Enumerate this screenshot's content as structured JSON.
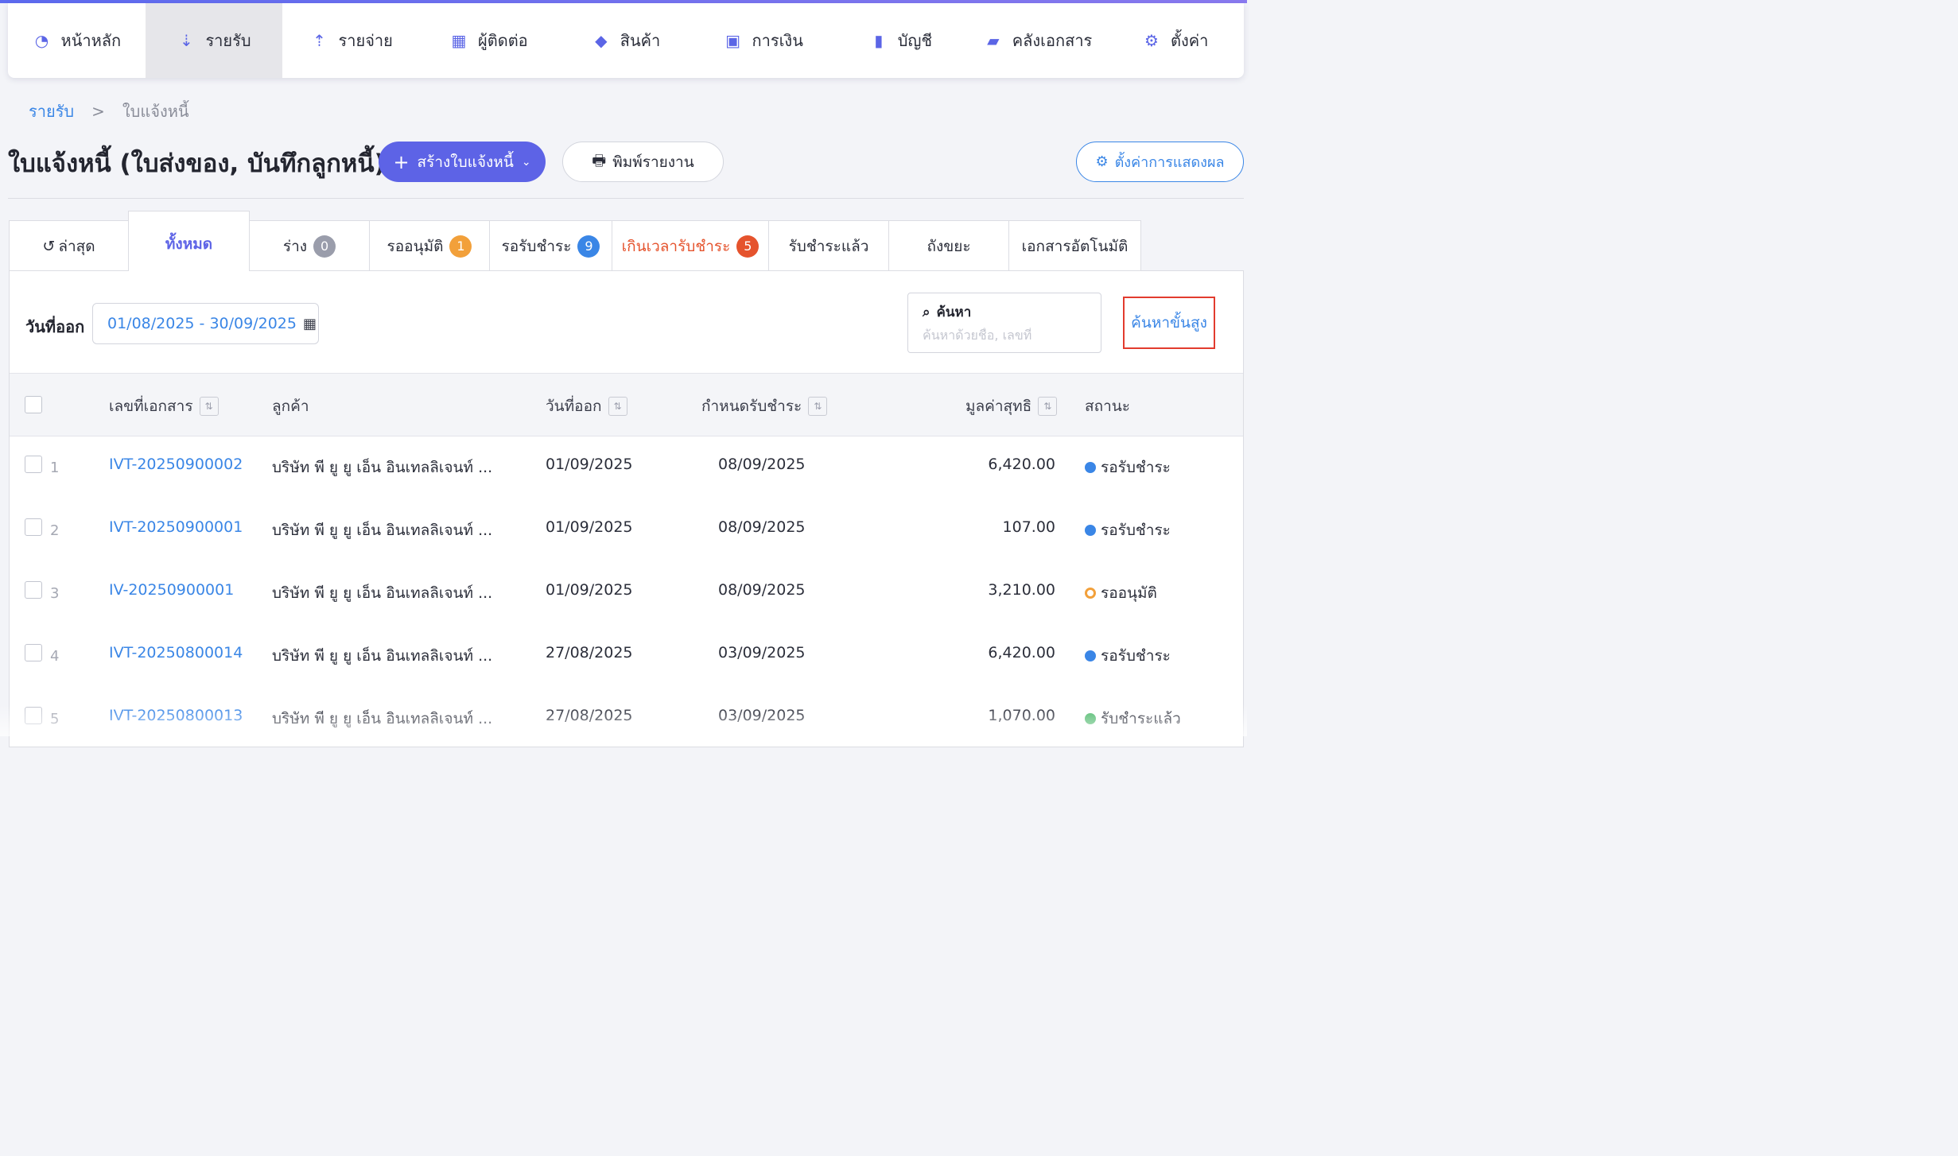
{
  "nav": {
    "items": [
      {
        "label": "หน้าหลัก",
        "icon": "gauge-icon",
        "glyph": "◔",
        "active": false
      },
      {
        "label": "รายรับ",
        "icon": "income-list-icon",
        "glyph": "⇣",
        "active": true
      },
      {
        "label": "รายจ่าย",
        "icon": "expense-list-icon",
        "glyph": "⇡",
        "active": false
      },
      {
        "label": "ผู้ติดต่อ",
        "icon": "building-icon",
        "glyph": "▦",
        "active": false
      },
      {
        "label": "สินค้า",
        "icon": "box-icon",
        "glyph": "◆",
        "active": false
      },
      {
        "label": "การเงิน",
        "icon": "money-icon",
        "glyph": "▣",
        "active": false
      },
      {
        "label": "บัญชี",
        "icon": "ledger-icon",
        "glyph": "▮",
        "active": false
      },
      {
        "label": "คลังเอกสาร",
        "icon": "folder-icon",
        "glyph": "▰",
        "active": false
      },
      {
        "label": "ตั้งค่า",
        "icon": "gear-icon",
        "glyph": "⚙",
        "active": false
      }
    ]
  },
  "breadcrumb": {
    "parent": "รายรับ",
    "separator": ">",
    "current": "ใบแจ้งหนี้"
  },
  "header": {
    "title": "ใบแจ้งหนี้ (ใบส่งของ, บันทึกลูกหนี้)",
    "create_label": "สร้างใบแจ้งหนี้",
    "print_label": "พิมพ์รายงาน",
    "display_settings_label": "ตั้งค่าการแสดงผล"
  },
  "tabs": [
    {
      "label": "ล่าสุด",
      "width": 151
    },
    {
      "label": "ทั้งหมด",
      "width": 153
    },
    {
      "label": "ร่าง",
      "badge": "0",
      "badge_color": "#9a9dab",
      "width": 152
    },
    {
      "label": "รออนุมัติ",
      "badge": "1",
      "badge_color": "#f2a03a",
      "width": 152
    },
    {
      "label": "รอรับชำระ",
      "badge": "9",
      "badge_color": "#3a86e6",
      "width": 155
    },
    {
      "label": "เกินเวลารับชำระ",
      "badge": "5",
      "badge_color": "#e5532d",
      "width": 198
    },
    {
      "label": "รับชำระแล้ว",
      "width": 152
    },
    {
      "label": "ถังขยะ",
      "width": 152
    },
    {
      "label": "เอกสารอัตโนมัติ",
      "width": 167
    }
  ],
  "filters": {
    "date_label": "วันที่ออก",
    "date_range": "01/08/2025 - 30/09/2025",
    "search_title": "ค้นหา",
    "search_placeholder": "ค้นหาด้วยชื่อ, เลขที่",
    "advanced_search_label": "ค้นหาขั้นสูง"
  },
  "table": {
    "columns": {
      "doc_no": "เลขที่เอกสาร",
      "customer": "ลูกค้า",
      "issue_date": "วันที่ออก",
      "due_date": "กำหนดรับชำระ",
      "net_value": "มูลค่าสุทธิ",
      "status": "สถานะ"
    },
    "rows": [
      {
        "num": "1",
        "doc_no": "IVT-20250900002",
        "customer": "บริษัท พี ยู ยู เอ็น อินเทลลิเจนท์ ...",
        "issue_date": "01/09/2025",
        "due_date": "08/09/2025",
        "net_value": "6,420.00",
        "status": "รอรับชำระ",
        "status_color": "#3a86e6",
        "ring": false
      },
      {
        "num": "2",
        "doc_no": "IVT-20250900001",
        "customer": "บริษัท พี ยู ยู เอ็น อินเทลลิเจนท์ ...",
        "issue_date": "01/09/2025",
        "due_date": "08/09/2025",
        "net_value": "107.00",
        "status": "รอรับชำระ",
        "status_color": "#3a86e6",
        "ring": false
      },
      {
        "num": "3",
        "doc_no": "IV-20250900001",
        "customer": "บริษัท พี ยู ยู เอ็น อินเทลลิเจนท์ ...",
        "issue_date": "01/09/2025",
        "due_date": "08/09/2025",
        "net_value": "3,210.00",
        "status": "รออนุมัติ",
        "status_color": "#f2a03a",
        "ring": true
      },
      {
        "num": "4",
        "doc_no": "IVT-20250800014",
        "customer": "บริษัท พี ยู ยู เอ็น อินเทลลิเจนท์ ...",
        "issue_date": "27/08/2025",
        "due_date": "03/09/2025",
        "net_value": "6,420.00",
        "status": "รอรับชำระ",
        "status_color": "#3a86e6",
        "ring": false
      },
      {
        "num": "5",
        "doc_no": "IVT-20250800013",
        "customer": "บริษัท พี ยู ยู เอ็น อินเทลลิเจนท์ ...",
        "issue_date": "27/08/2025",
        "due_date": "03/09/2025",
        "net_value": "1,070.00",
        "status": "รับชำระแล้ว",
        "status_color": "#4cb86a",
        "ring": false
      }
    ]
  }
}
